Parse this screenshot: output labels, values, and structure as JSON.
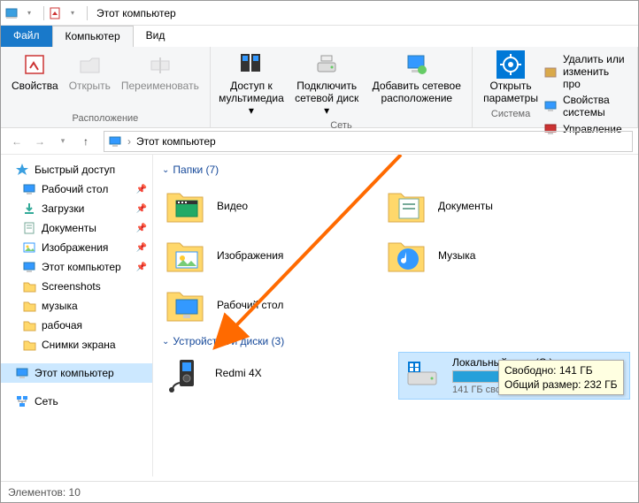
{
  "title": "Этот компьютер",
  "tabs": {
    "file": "Файл",
    "computer": "Компьютер",
    "view": "Вид"
  },
  "ribbon": {
    "location": {
      "label": "Расположение",
      "props": "Свойства",
      "open": "Открыть",
      "rename": "Переименовать"
    },
    "network": {
      "label": "Сеть",
      "media": "Доступ к мультимедиа",
      "media_arrow": "▾",
      "netdrive": "Подключить сетевой диск",
      "netdrive_arrow": "▾",
      "addnet": "Добавить сетевое расположение"
    },
    "system": {
      "label": "Система",
      "settings": "Открыть параметры",
      "remove": "Удалить или изменить про",
      "sysprops": "Свойства системы",
      "manage": "Управление"
    }
  },
  "breadcrumb": {
    "root": "Этот компьютер",
    "sep": "›"
  },
  "sidebar": {
    "quick": "Быстрый доступ",
    "items": [
      {
        "label": "Рабочий стол",
        "pin": true,
        "icon": "desktop"
      },
      {
        "label": "Загрузки",
        "pin": true,
        "icon": "downloads"
      },
      {
        "label": "Документы",
        "pin": true,
        "icon": "documents"
      },
      {
        "label": "Изображения",
        "pin": true,
        "icon": "pictures"
      },
      {
        "label": "Этот компьютер",
        "pin": true,
        "icon": "pc"
      },
      {
        "label": "Screenshots",
        "pin": false,
        "icon": "folder"
      },
      {
        "label": "музыка",
        "pin": false,
        "icon": "folder"
      },
      {
        "label": "рабочая",
        "pin": false,
        "icon": "folder"
      },
      {
        "label": "Снимки экрана",
        "pin": false,
        "icon": "folder"
      }
    ],
    "thispc": "Этот компьютер",
    "network": "Сеть"
  },
  "sections": {
    "folders": {
      "title": "Папки (7)"
    },
    "drives": {
      "title": "Устройства и диски (3)"
    }
  },
  "folders": [
    {
      "label": "Видео",
      "icon": "video"
    },
    {
      "label": "Документы",
      "icon": "documents"
    },
    {
      "label": "Изображения",
      "icon": "pictures"
    },
    {
      "label": "Музыка",
      "icon": "music"
    },
    {
      "label": "Рабочий стол",
      "icon": "desktop"
    }
  ],
  "devices": [
    {
      "label": "Redmi 4X",
      "type": "media"
    },
    {
      "label": "Локальный диск (C:)",
      "type": "drive",
      "free": "141 ГБ свободно",
      "bar_pct": 39
    }
  ],
  "tooltip": {
    "line1": "Свободно: 141 ГБ",
    "line2": "Общий размер: 232 ГБ"
  },
  "status": {
    "count": "Элементов: 10"
  }
}
